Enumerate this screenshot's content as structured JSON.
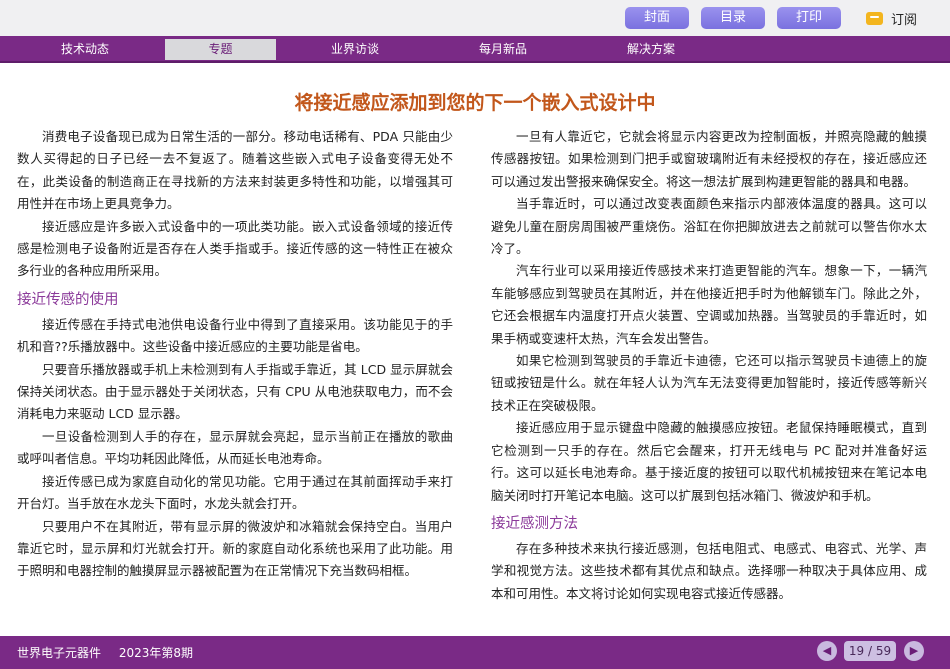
{
  "toolbar": {
    "cover_label": "封面",
    "toc_label": "目录",
    "print_label": "打印",
    "subscribe_label": "订阅"
  },
  "nav": {
    "items": [
      {
        "label": "技术动态"
      },
      {
        "label": "专题"
      },
      {
        "label": "业界访谈"
      },
      {
        "label": "每月新品"
      },
      {
        "label": "解决方案"
      }
    ],
    "active_index": 1
  },
  "article": {
    "title": "将接近感应添加到您的下一个嵌入式设计中",
    "left": {
      "p1": "消费电子设备现已成为日常生活的一部分。移动电话稀有、PDA 只能由少数人买得起的日子已经一去不复返了。随着这些嵌入式电子设备变得无处不在，此类设备的制造商正在寻找新的方法来封装更多特性和功能，以增强其可用性并在市场上更具竞争力。",
      "p2": "接近感应是许多嵌入式设备中的一项此类功能。嵌入式设备领域的接近传感是检测电子设备附近是否存在人类手指或手。接近传感的这一特性正在被众多行业的各种应用所采用。",
      "h1": "接近传感的使用",
      "p3": "接近传感在手持式电池供电设备行业中得到了直接采用。该功能见于的手机和音??乐播放器中。这些设备中接近感应的主要功能是省电。",
      "p4": "只要音乐播放器或手机上未检测到有人手指或手靠近，其 LCD 显示屏就会保持关闭状态。由于显示器处于关闭状态，只有 CPU 从电池获取电力，而不会消耗电力来驱动 LCD 显示器。",
      "p5": "一旦设备检测到人手的存在，显示屏就会亮起，显示当前正在播放的歌曲或呼叫者信息。平均功耗因此降低，从而延长电池寿命。",
      "p6": "接近传感已成为家庭自动化的常见功能。它用于通过在其前面挥动手来打开台灯。当手放在水龙头下面时，水龙头就会打开。",
      "p7": "只要用户不在其附近，带有显示屏的微波炉和冰箱就会保持空白。当用户靠近它时，显示屏和灯光就会打开。新的家庭自动化系统也采用了此功能。用于照明和电器控制的触摸屏显示器被配置为在正常情况下充当数码相框。"
    },
    "right": {
      "p1": "一旦有人靠近它，它就会将显示内容更改为控制面板，并照亮隐藏的触摸传感器按钮。如果检测到门把手或窗玻璃附近有未经授权的存在，接近感应还可以通过发出警报来确保安全。将这一想法扩展到构建更智能的器具和电器。",
      "p2": "当手靠近时，可以通过改变表面颜色来指示内部液体温度的器具。这可以避免儿童在厨房周围被严重烧伤。浴缸在你把脚放进去之前就可以警告你水太冷了。",
      "p3": "汽车行业可以采用接近传感技术来打造更智能的汽车。想象一下，一辆汽车能够感应到驾驶员在其附近，并在他接近把手时为他解锁车门。除此之外，它还会根据车内温度打开点火装置、空调或加热器。当驾驶员的手靠近时，如果手柄或变速杆太热，汽车会发出警告。",
      "p4": "如果它检测到驾驶员的手靠近卡迪德，它还可以指示驾驶员卡迪德上的旋钮或按钮是什么。就在年轻人认为汽车无法变得更加智能时，接近传感等新兴技术正在突破极限。",
      "p5": "接近感应用于显示键盘中隐藏的触摸感应按钮。老鼠保持睡眠模式，直到它检测到一只手的存在。然后它会醒来，打开无线电与 PC 配对并准备好运行。这可以延长电池寿命。基于接近度的按钮可以取代机械按钮来在笔记本电脑关闭时打开笔记本电脑。这可以扩展到包括冰箱门、微波炉和手机。",
      "h1": "接近感测方法",
      "p6": "存在多种技术来执行接近感测，包括电阻式、电感式、电容式、光学、声学和视觉方法。这些技术都有其优点和缺点。选择哪一种取决于具体应用、成本和可用性。本文将讨论如何实现电容式接近传感器。"
    }
  },
  "footer": {
    "publication": "世界电子元器件",
    "issue": "2023年第8期",
    "page_indicator": "19 / 59"
  },
  "colors": {
    "nav_bg": "#7a2a86",
    "title": "#c2571b",
    "heading": "#8b3a9a",
    "button": "#8a80e6"
  },
  "icons": {
    "subscribe": "envelope-icon",
    "prev": "chevron-left-icon",
    "next": "chevron-right-icon"
  }
}
